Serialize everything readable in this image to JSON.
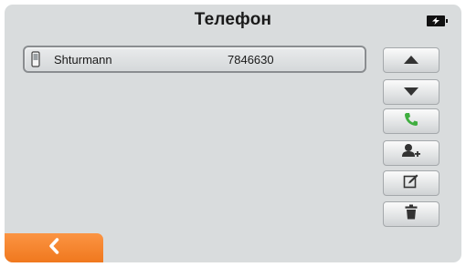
{
  "header": {
    "title": "Телефон",
    "battery_icon": "battery-charging-icon"
  },
  "contacts": [
    {
      "icon": "mobile-phone-icon",
      "name": "Shturmann",
      "number": "7846630"
    }
  ],
  "side_buttons": [
    {
      "icon": "arrow-up-icon"
    },
    {
      "icon": "arrow-down-icon"
    },
    {
      "icon": "call-icon",
      "color": "#3fae3f"
    },
    {
      "icon": "add-contact-icon"
    },
    {
      "icon": "edit-icon"
    },
    {
      "icon": "trash-icon"
    }
  ],
  "footer": {
    "back_icon": "chevron-left-icon",
    "back_color": "#f28228"
  },
  "colors": {
    "background": "#d9dcdd",
    "accent": "#f28228"
  }
}
